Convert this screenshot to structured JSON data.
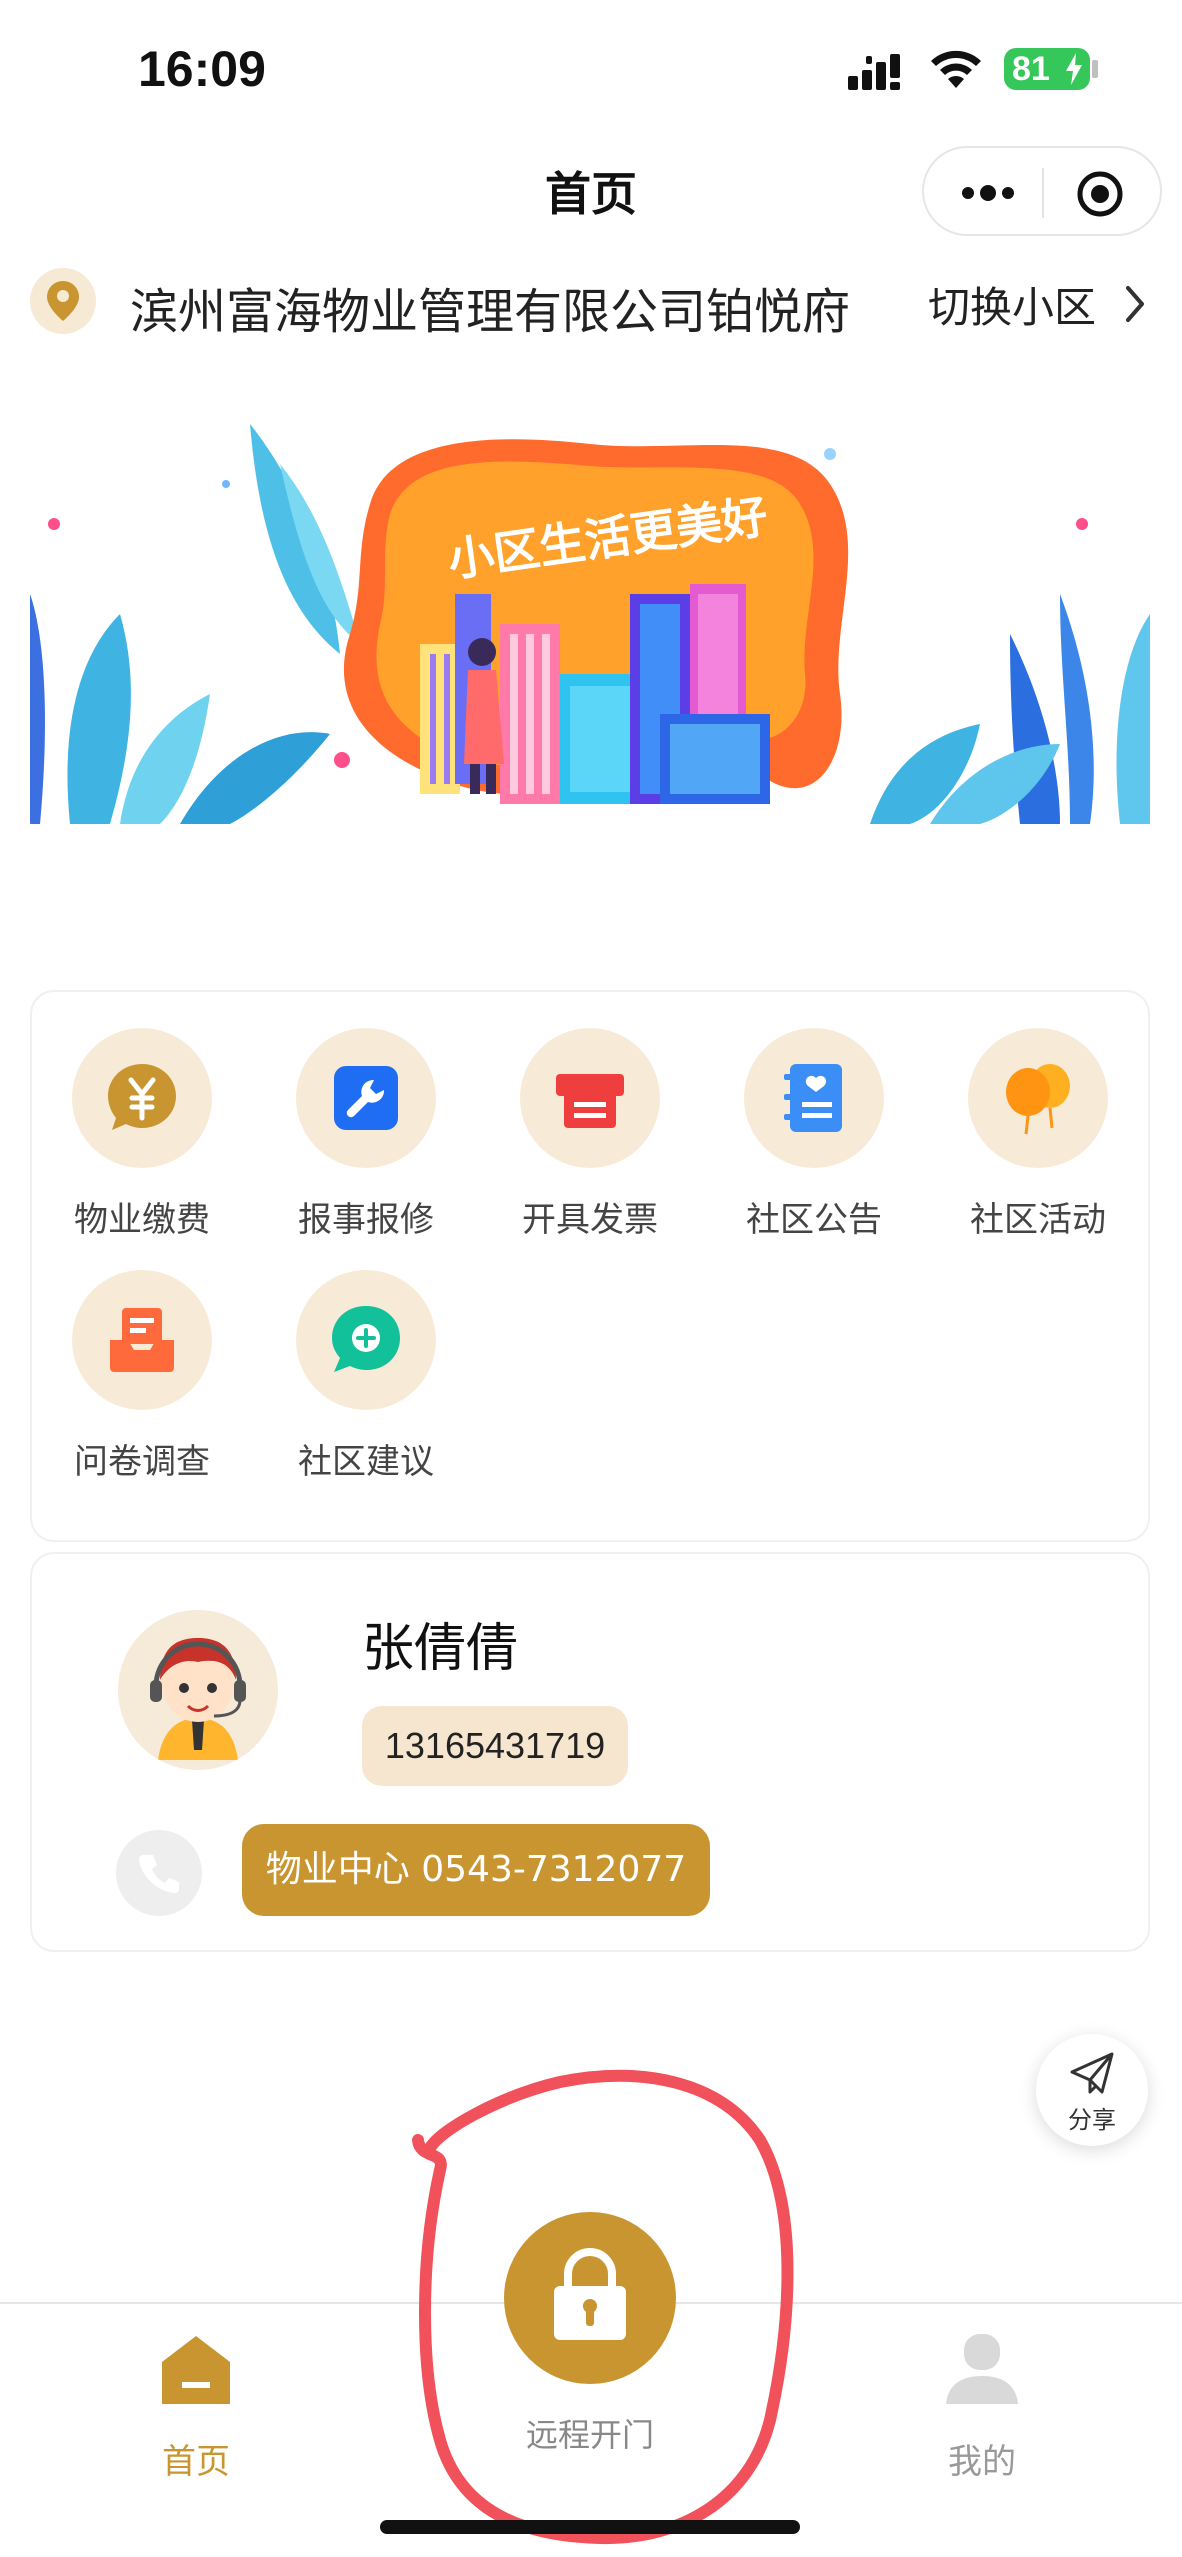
{
  "status_bar": {
    "time": "16:09",
    "battery": "81"
  },
  "nav": {
    "title": "首页"
  },
  "location": {
    "name": "滨州富海物业管理有限公司铂悦府",
    "switch_label": "切换小区"
  },
  "banner": {
    "text": "小区生活更美好"
  },
  "services": [
    {
      "label": "物业缴费",
      "icon": "yuan-bubble-icon"
    },
    {
      "label": "报事报修",
      "icon": "wrench-icon"
    },
    {
      "label": "开具发票",
      "icon": "invoice-printer-icon"
    },
    {
      "label": "社区公告",
      "icon": "notice-book-icon"
    },
    {
      "label": "社区活动",
      "icon": "balloon-icon"
    },
    {
      "label": "问卷调查",
      "icon": "survey-tray-icon"
    },
    {
      "label": "社区建议",
      "icon": "suggestion-chat-icon"
    }
  ],
  "contact": {
    "name": "张倩倩",
    "phone": "13165431719",
    "center_label": "物业中心 0543-7312077"
  },
  "share": {
    "label": "分享"
  },
  "tabbar": {
    "home": "首页",
    "unlock": "远程开门",
    "mine": "我的"
  },
  "colors": {
    "accent": "#c99530",
    "accent_light": "#f7ebd8",
    "battery_green": "#35c759",
    "annotation_red": "#f0515a"
  }
}
